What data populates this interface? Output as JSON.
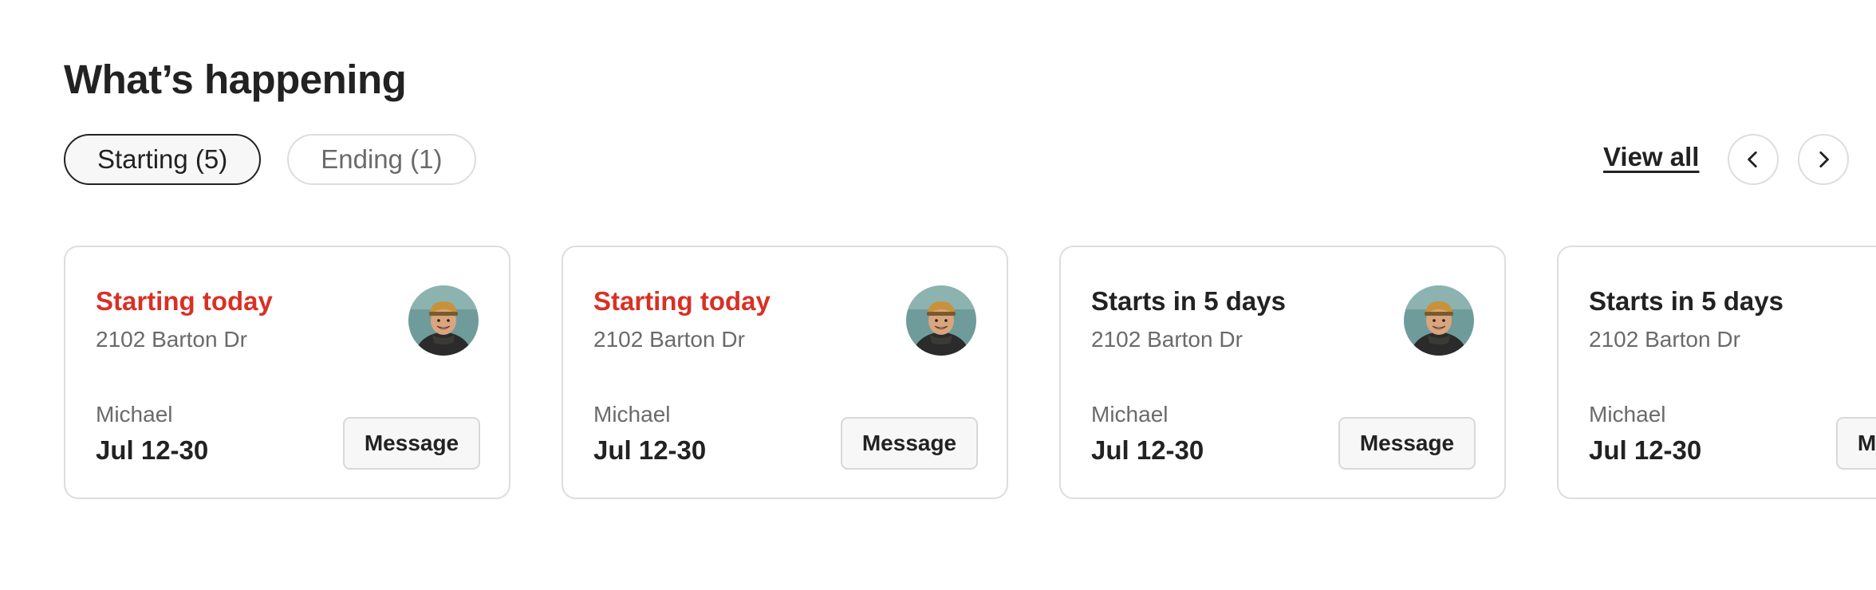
{
  "section": {
    "title": "What’s happening"
  },
  "filters": [
    {
      "label": "Starting (5)",
      "active": true
    },
    {
      "label": "Ending (1)",
      "active": false
    }
  ],
  "view_all_label": "View all",
  "navigation": {
    "prev_icon": "chevron-left-icon",
    "next_icon": "chevron-right-icon"
  },
  "colors": {
    "urgent_status": "#d93025",
    "default_status": "#222222"
  },
  "cards": [
    {
      "status": "Starting today",
      "urgent": true,
      "address": "2102 Barton Dr",
      "guest": "Michael",
      "dates": "Jul 12-30",
      "button": "Message",
      "avatar_icon": "guest-avatar"
    },
    {
      "status": "Starting today",
      "urgent": true,
      "address": "2102 Barton Dr",
      "guest": "Michael",
      "dates": "Jul 12-30",
      "button": "Message",
      "avatar_icon": "guest-avatar"
    },
    {
      "status": "Starts in 5 days",
      "urgent": false,
      "address": "2102 Barton Dr",
      "guest": "Michael",
      "dates": "Jul 12-30",
      "button": "Message",
      "avatar_icon": "guest-avatar"
    },
    {
      "status": "Starts in 5 days",
      "urgent": false,
      "address": "2102 Barton Dr",
      "guest": "Michael",
      "dates": "Jul 12-30",
      "button": "Message",
      "avatar_icon": "guest-avatar"
    }
  ]
}
